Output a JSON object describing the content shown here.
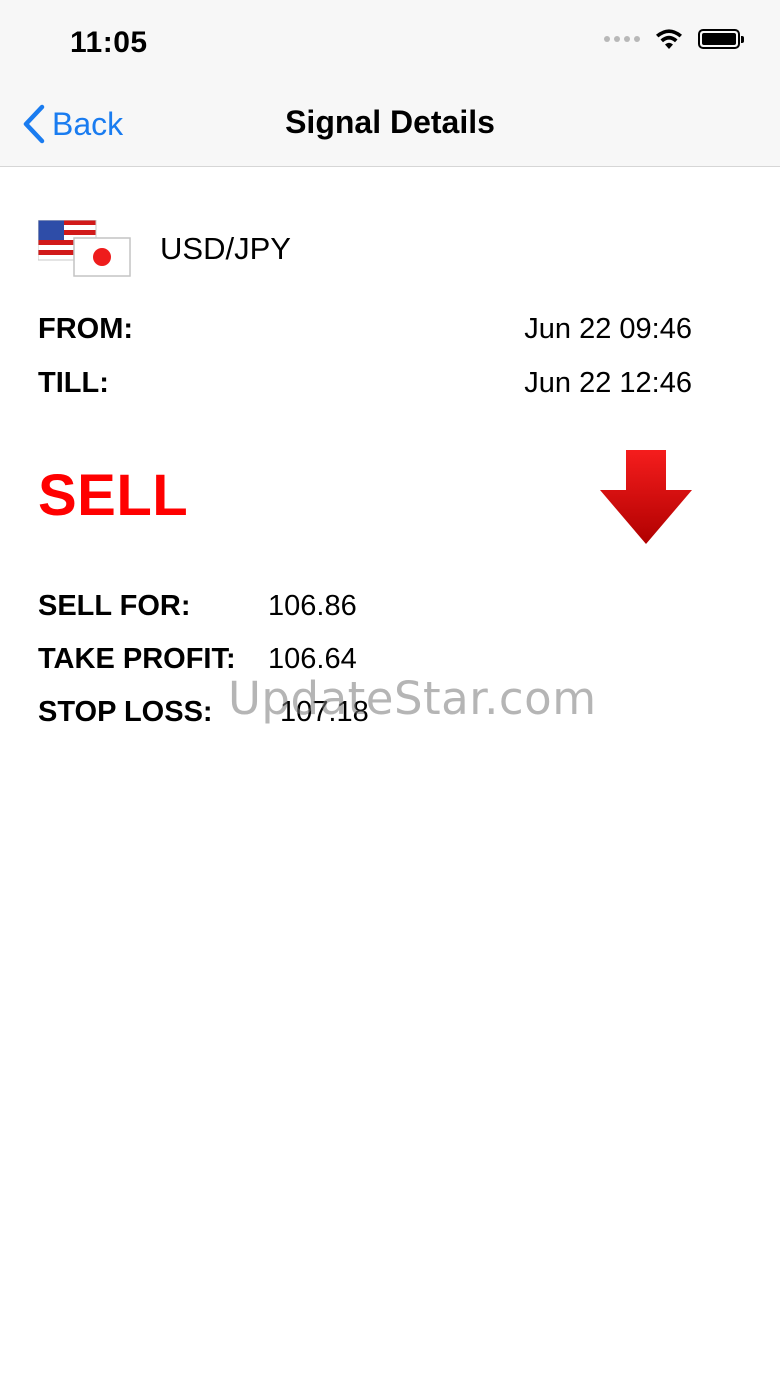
{
  "status": {
    "time": "11:05"
  },
  "nav": {
    "back_label": "Back",
    "title": "Signal Details"
  },
  "signal": {
    "pair": "USD/JPY",
    "from_label": "FROM:",
    "from_value": "Jun 22 09:46",
    "till_label": "TILL:",
    "till_value": "Jun 22 12:46",
    "action": "SELL",
    "action_color": "#ff0000",
    "direction_icon": "arrow-down-icon",
    "details": [
      {
        "label": "SELL FOR:",
        "value": "106.86"
      },
      {
        "label": "TAKE PROFIT:",
        "value": "106.64"
      },
      {
        "label": "STOP LOSS:",
        "value": "107.18"
      }
    ]
  },
  "watermark": "UpdateStar.com",
  "colors": {
    "accent": "#1a7cf0",
    "sell": "#ff0000"
  }
}
